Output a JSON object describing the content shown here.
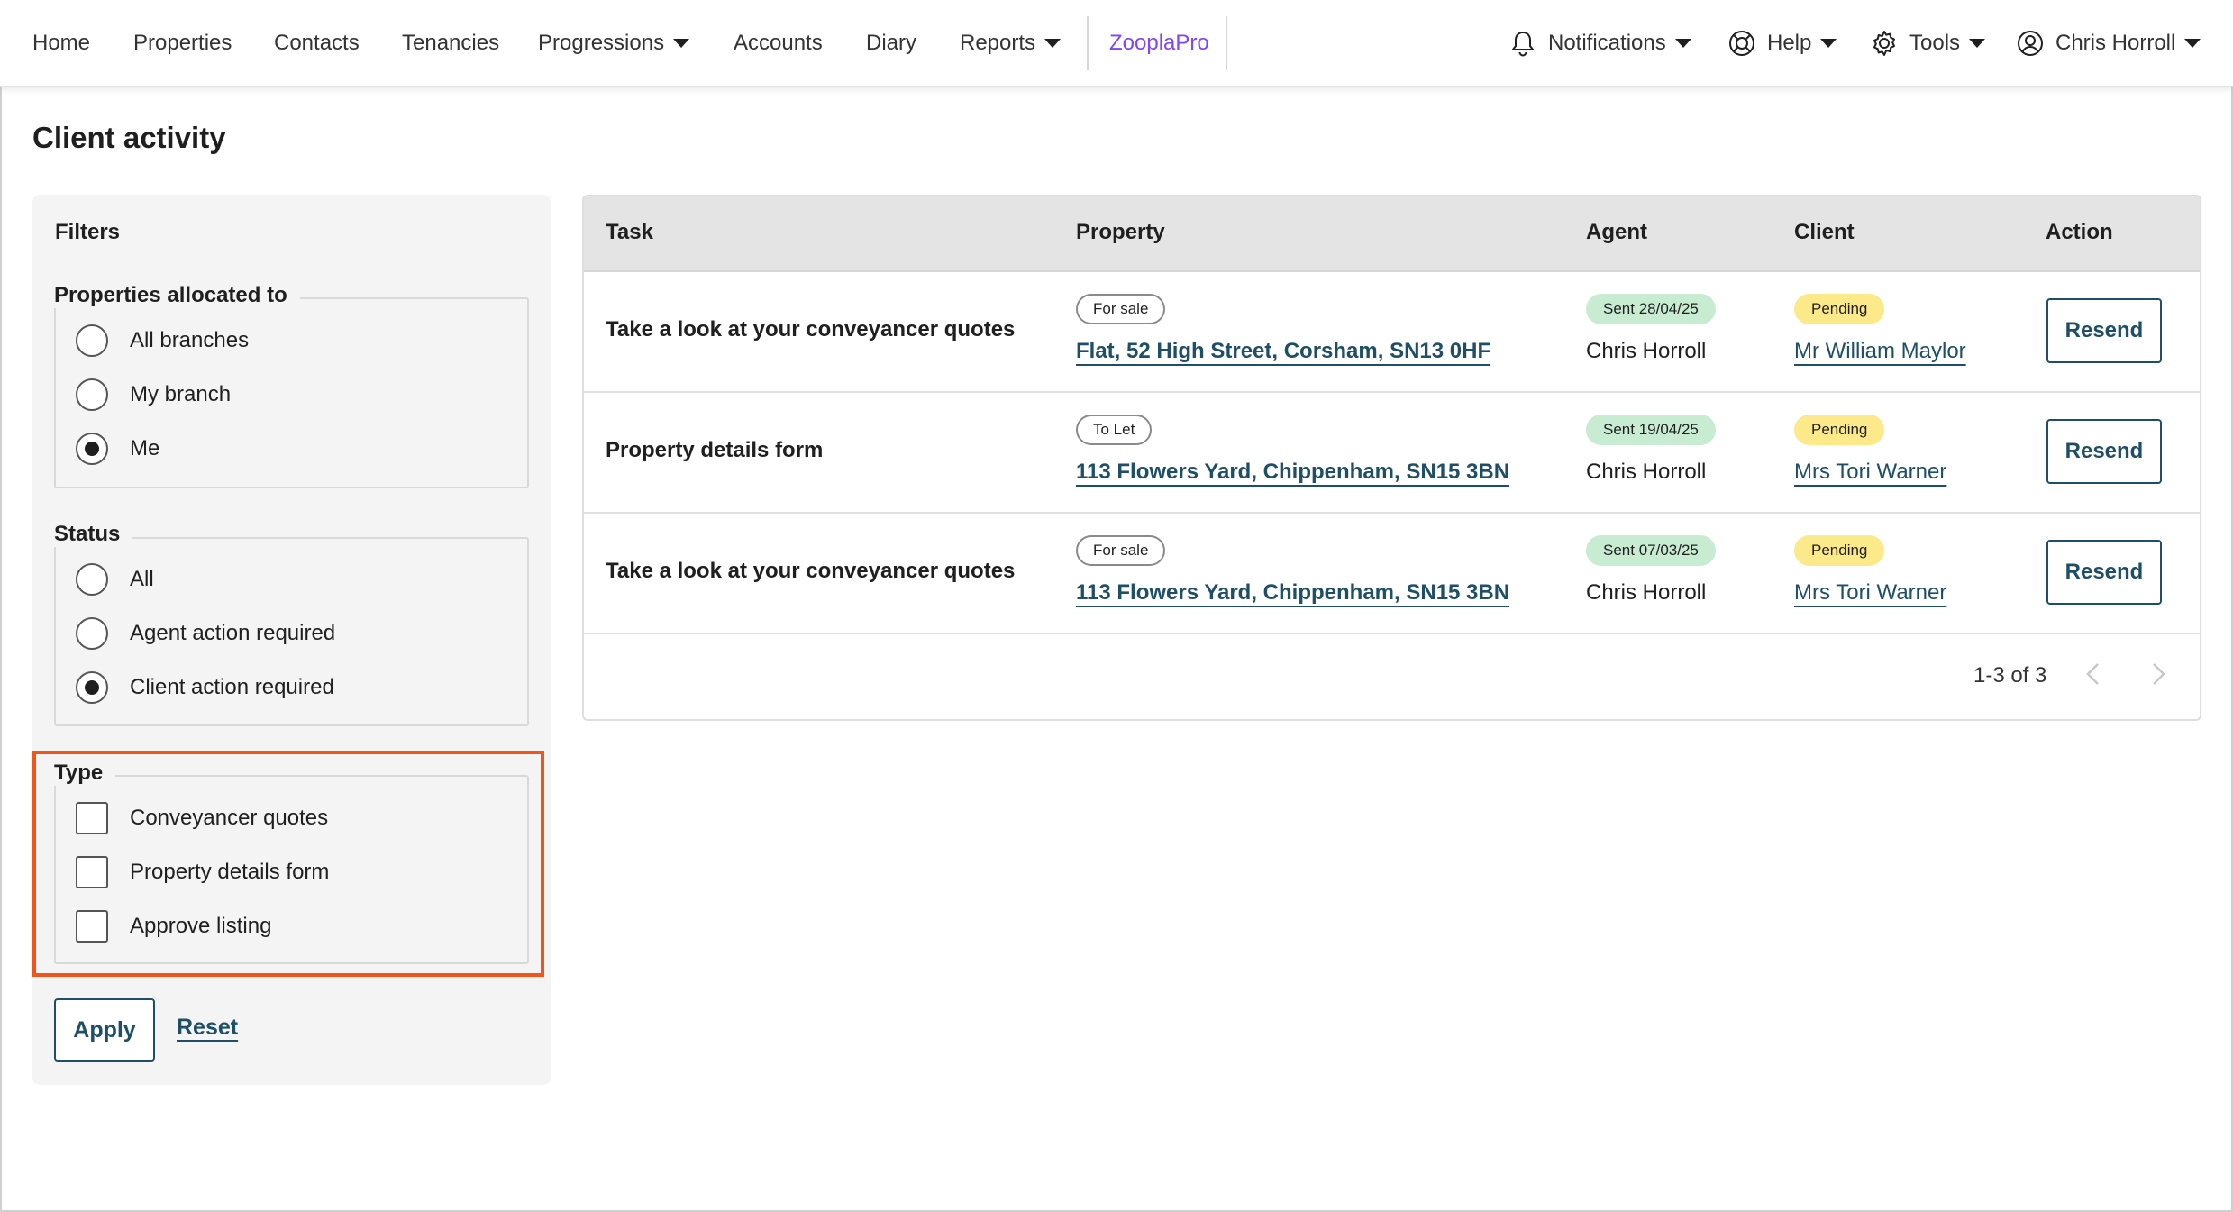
{
  "nav": {
    "home": "Home",
    "properties": "Properties",
    "contacts": "Contacts",
    "tenancies": "Tenancies",
    "progressions": "Progressions",
    "accounts": "Accounts",
    "diary": "Diary",
    "reports": "Reports",
    "zooplapro": "ZooplaPro",
    "notifications": "Notifications",
    "help": "Help",
    "tools": "Tools",
    "user": "Chris Horroll"
  },
  "colors": {
    "accent_link": "#1e4f66",
    "zooplapro": "#8046f1",
    "highlight_box": "#f1551c",
    "sent_badge": "#c7ecd2",
    "pending_badge": "#fbe98a"
  },
  "page": {
    "title": "Client activity"
  },
  "filters": {
    "title": "Filters",
    "allocated": {
      "legend": "Properties allocated to",
      "options": [
        "All branches",
        "My branch",
        "Me"
      ],
      "selected": "Me"
    },
    "status": {
      "legend": "Status",
      "options": [
        "All",
        "Agent action required",
        "Client action required"
      ],
      "selected": "Client action required"
    },
    "type": {
      "legend": "Type",
      "options": [
        "Conveyancer quotes",
        "Property details form",
        "Approve listing"
      ]
    },
    "apply": "Apply",
    "reset": "Reset"
  },
  "table": {
    "headers": [
      "Task",
      "Property",
      "Agent",
      "Client",
      "Action"
    ],
    "rows": [
      {
        "task": "Take a look at your conveyancer quotes",
        "listing": "For sale",
        "property": "Flat, 52 High Street, Corsham, SN13 0HF",
        "sent": "Sent 28/04/25",
        "agent": "Chris Horroll",
        "status": "Pending",
        "client": "Mr William Maylor",
        "action": "Resend"
      },
      {
        "task": "Property details form",
        "listing": "To Let",
        "property": "113 Flowers Yard, Chippenham, SN15 3BN",
        "sent": "Sent 19/04/25",
        "agent": "Chris Horroll",
        "status": "Pending",
        "client": "Mrs Tori Warner",
        "action": "Resend"
      },
      {
        "task": "Take a look at your conveyancer quotes",
        "listing": "For sale",
        "property": "113 Flowers Yard, Chippenham, SN15 3BN",
        "sent": "Sent 07/03/25",
        "agent": "Chris Horroll",
        "status": "Pending",
        "client": "Mrs Tori Warner",
        "action": "Resend"
      }
    ],
    "pagination": "1-3 of 3"
  }
}
